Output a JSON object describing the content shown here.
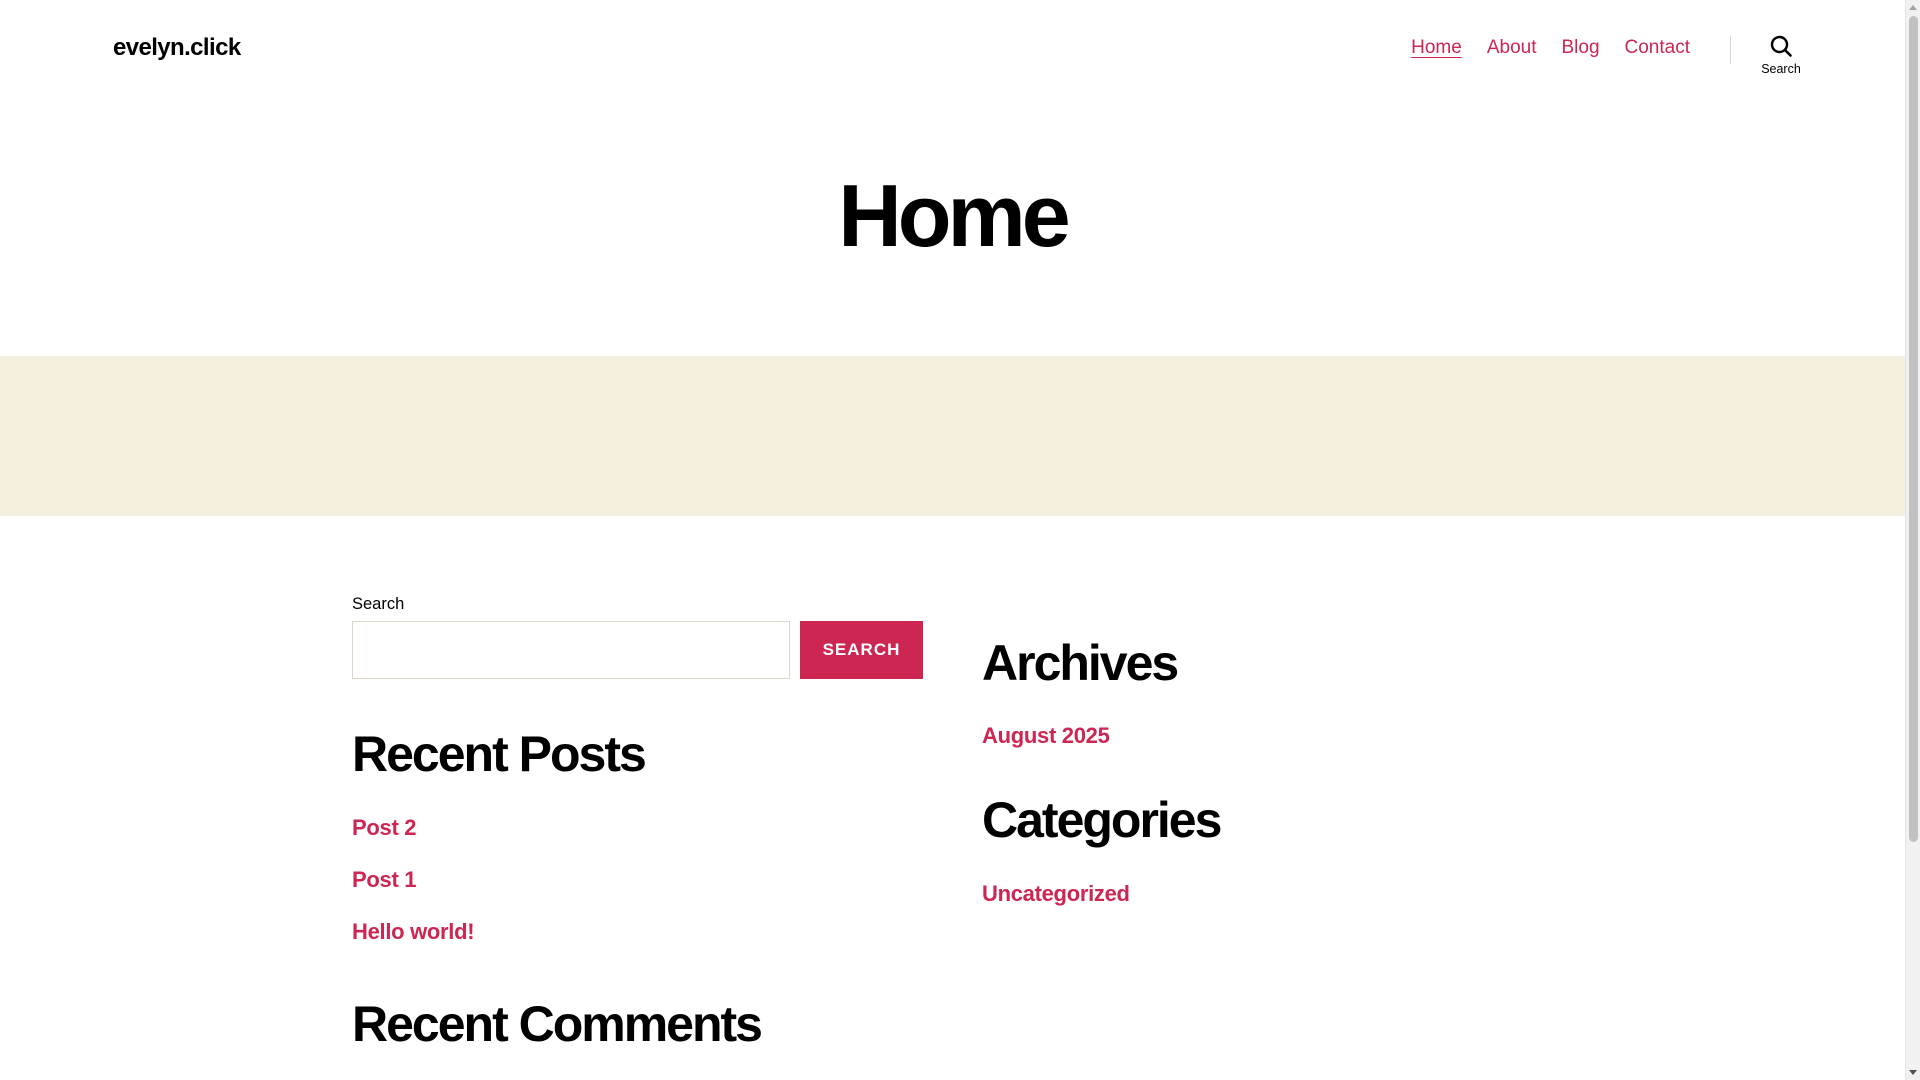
{
  "header": {
    "site_title": "evelyn.click",
    "nav": [
      {
        "label": "Home",
        "current": true
      },
      {
        "label": "About",
        "current": false
      },
      {
        "label": "Blog",
        "current": false
      },
      {
        "label": "Contact",
        "current": false
      }
    ],
    "search_toggle_label": "Search",
    "search_icon": "search-icon"
  },
  "entry": {
    "title": "Home"
  },
  "widgets": {
    "search": {
      "label": "Search",
      "input_value": "",
      "button_label": "Search"
    },
    "recent_posts": {
      "title": "Recent Posts",
      "items": [
        "Post 2",
        "Post 1",
        "Hello world!"
      ]
    },
    "recent_comments": {
      "title": "Recent Comments"
    },
    "archives": {
      "title": "Archives",
      "items": [
        "August 2025"
      ]
    },
    "categories": {
      "title": "Categories",
      "items": [
        "Uncategorized"
      ]
    }
  },
  "colors": {
    "accent": "#cd2653",
    "cover_band": "#f5efe0",
    "text": "#000000",
    "border": "#dcd7ca"
  }
}
